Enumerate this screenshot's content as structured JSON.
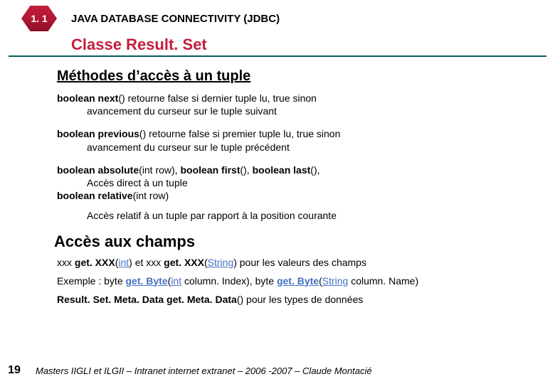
{
  "header": {
    "badge": "1. 1",
    "title": "JAVA DATABASE CONNECTIVITY (JDBC)"
  },
  "sectionTitle": "Classe Result. Set",
  "sub1": "Méthodes d’accès à un tuple",
  "m1": {
    "sig_a": "boolean next",
    "sig_b": "() retourne false si dernier tuple lu, true sinon",
    "desc": "avancement du curseur sur le tuple suivant"
  },
  "m2": {
    "sig_a": "boolean previous",
    "sig_b": "() retourne false si premier tuple lu, true sinon",
    "desc": "avancement du curseur sur le tuple précédent"
  },
  "m3": {
    "a1": "boolean absolute",
    "a2": "(int row), ",
    "b1": "boolean first",
    "b2": "(), ",
    "c1": "boolean last",
    "c2": "(),",
    "desc": "Accès direct à un tuple",
    "d1": "boolean relative",
    "d2": "(int row)",
    "desc2": "Accès relatif à un tuple par rapport à la position courante"
  },
  "sub2": "Accès aux champs",
  "p1": {
    "a": "xxx ",
    "b": "get. XXX",
    "c": "(",
    "d": "int",
    "e": ") et xxx ",
    "f": "get. XXX",
    "g": "(",
    "h": "String",
    "i": ") pour les valeurs des champs"
  },
  "p2": {
    "a": "Exemple : byte ",
    "b": "get. Byte",
    "c": "(",
    "d": "int",
    "e": " column. Index), byte ",
    "f": "get. Byte",
    "g": "(",
    "h": "String",
    "i": " column. Name)"
  },
  "p3": {
    "a": "Result. Set. Meta. Data get. Meta. Data",
    "b": "() pour les types de données"
  },
  "footer": {
    "page": "19",
    "text": "Masters IIGLI et ILGII – Intranet internet extranet – 2006 -2007 – Claude Montacié"
  }
}
